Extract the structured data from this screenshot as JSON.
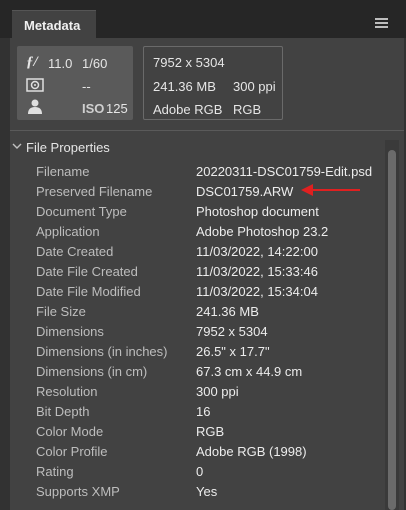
{
  "panel": {
    "tab_label": "Metadata",
    "menu_icon": "hamburger-menu-icon"
  },
  "camera": {
    "f_icon": "aperture-f-icon",
    "f_number": "11.0",
    "shutter": "1/60",
    "metering_icon": "metering-icon",
    "metering_value": "--",
    "person_icon": "person-icon",
    "iso_label": "ISO",
    "iso_value": "125"
  },
  "image_info": {
    "dimensions": "7952 x 5304",
    "size": "241.36 MB",
    "resolution": "300 ppi",
    "profile": "Adobe RGB",
    "mode": "RGB"
  },
  "section": {
    "title": "File Properties",
    "chevron_icon": "chevron-down-icon"
  },
  "properties": [
    {
      "key": "Filename",
      "value": "20220311-DSC01759-Edit.psd"
    },
    {
      "key": "Preserved Filename",
      "value": "DSC01759.ARW"
    },
    {
      "key": "Document Type",
      "value": "Photoshop document"
    },
    {
      "key": "Application",
      "value": "Adobe Photoshop 23.2"
    },
    {
      "key": "Date Created",
      "value": "11/03/2022, 14:22:00"
    },
    {
      "key": "Date File Created",
      "value": "11/03/2022, 15:33:46"
    },
    {
      "key": "Date File Modified",
      "value": "11/03/2022, 15:34:04"
    },
    {
      "key": "File Size",
      "value": "241.36 MB"
    },
    {
      "key": "Dimensions",
      "value": "7952 x 5304"
    },
    {
      "key": "Dimensions (in inches)",
      "value": "26.5\" x 17.7\""
    },
    {
      "key": "Dimensions (in cm)",
      "value": "67.3 cm x 44.9 cm"
    },
    {
      "key": "Resolution",
      "value": "300 ppi"
    },
    {
      "key": "Bit Depth",
      "value": "16"
    },
    {
      "key": "Color Mode",
      "value": "RGB"
    },
    {
      "key": "Color Profile",
      "value": "Adobe RGB (1998)"
    },
    {
      "key": "Rating",
      "value": "0"
    },
    {
      "key": "Supports XMP",
      "value": "Yes"
    }
  ],
  "annotation": {
    "arrow_color": "#e02020"
  }
}
